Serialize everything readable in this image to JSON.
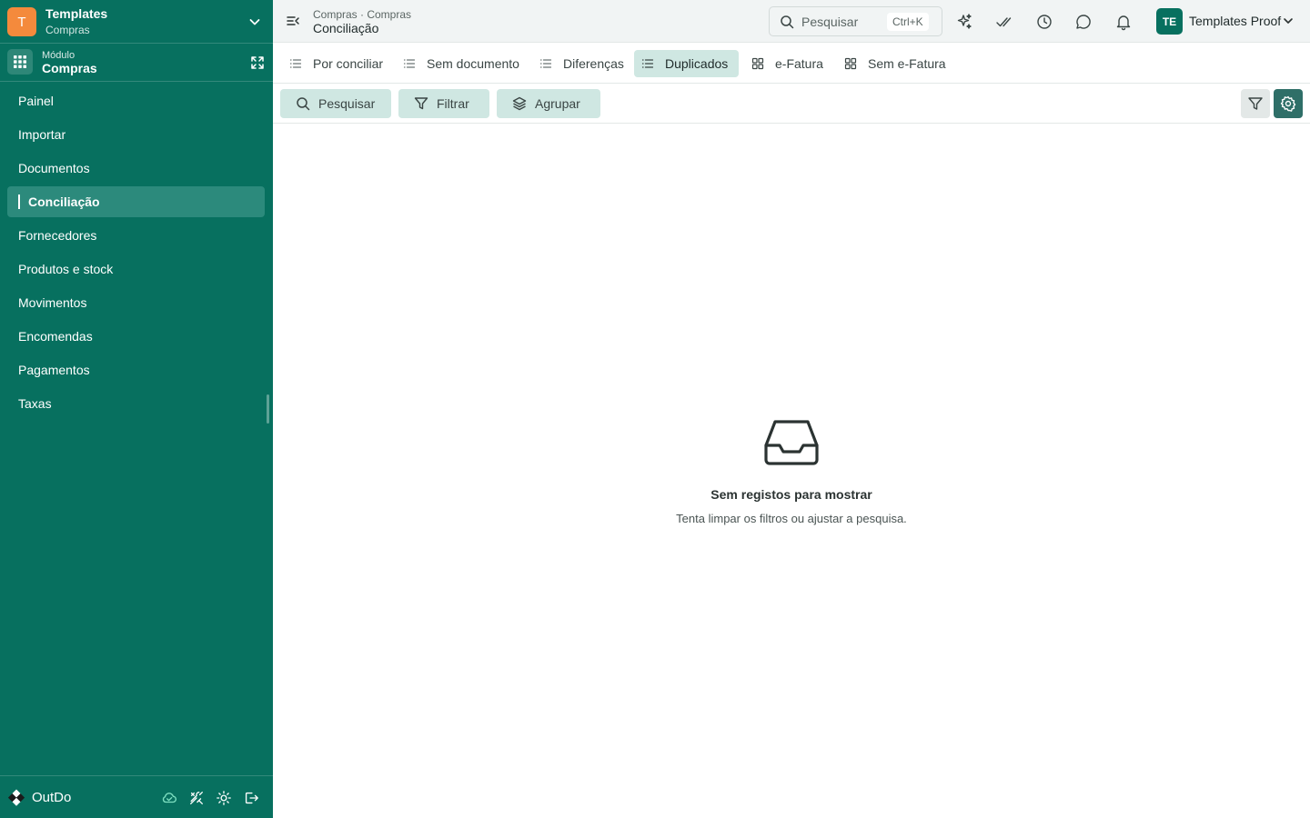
{
  "workspace": {
    "avatar_letter": "T",
    "name": "Templates",
    "subtitle": "Compras"
  },
  "module": {
    "label": "Módulo",
    "name": "Compras"
  },
  "sidebar": {
    "items": [
      {
        "label": "Painel"
      },
      {
        "label": "Importar"
      },
      {
        "label": "Documentos"
      },
      {
        "label": "Conciliação",
        "active": true
      },
      {
        "label": "Fornecedores"
      },
      {
        "label": "Produtos e stock"
      },
      {
        "label": "Movimentos"
      },
      {
        "label": "Encomendas"
      },
      {
        "label": "Pagamentos"
      },
      {
        "label": "Taxas"
      }
    ]
  },
  "footer": {
    "brand": "OutDo",
    "icons": [
      "cloud-check-icon",
      "tools-icon",
      "sun-icon",
      "logout-icon"
    ]
  },
  "topbar": {
    "breadcrumb": "Compras · Compras",
    "title": "Conciliação",
    "search": {
      "placeholder": "Pesquisar",
      "shortcut": "Ctrl+K"
    },
    "icons": [
      "sparkles-icon",
      "double-check-icon",
      "clock-icon",
      "chat-icon",
      "bell-icon"
    ],
    "user": {
      "initials": "TE",
      "name": "Templates Proof"
    }
  },
  "tabs": [
    {
      "label": "Por conciliar",
      "icon": "list-icon"
    },
    {
      "label": "Sem documento",
      "icon": "list-icon"
    },
    {
      "label": "Diferenças",
      "icon": "list-icon"
    },
    {
      "label": "Duplicados",
      "icon": "list-icon",
      "active": true
    },
    {
      "label": "e-Fatura",
      "icon": "grid-icon"
    },
    {
      "label": "Sem e-Fatura",
      "icon": "grid-icon"
    }
  ],
  "toolbar": {
    "search_label": "Pesquisar",
    "filter_label": "Filtrar",
    "group_label": "Agrupar"
  },
  "empty_state": {
    "title": "Sem registos para mostrar",
    "subtitle": "Tenta limpar os filtros ou ajustar a pesquisa."
  },
  "colors": {
    "sidebar": "#07705f",
    "accent_orange": "#f48a3c",
    "tab_active": "#cfe7e2",
    "settings_button": "#2f6f68"
  }
}
